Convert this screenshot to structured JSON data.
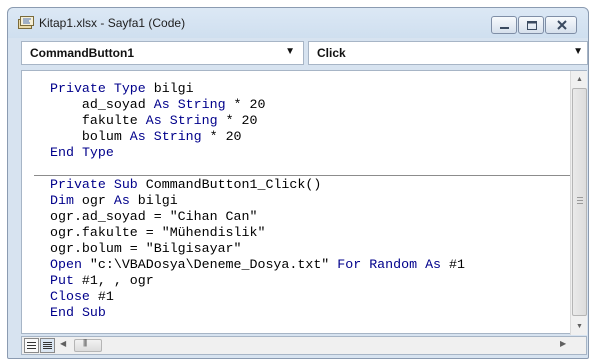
{
  "window": {
    "title": "Kitap1.xlsx - Sayfa1 (Code)",
    "icon": "vba-module-icon",
    "buttons": [
      "minimize-icon",
      "maximize-icon",
      "close-icon"
    ]
  },
  "object_combo": {
    "value": "CommandButton1"
  },
  "procedure_combo": {
    "value": "Click"
  },
  "code": {
    "lines": [
      "Private Type bilgi",
      "    ad_soyad As String * 20",
      "    fakulte As String * 20",
      "    bolum As String * 20",
      "End Type",
      "Private Sub CommandButton1_Click()",
      "Dim ogr As bilgi",
      "ogr.ad_soyad = \"Cihan Can\"",
      "ogr.fakulte = \"Mühendislik\"",
      "ogr.bolum = \"Bilgisayar\"",
      "Open \"c:\\VBADosya\\Deneme_Dosya.txt\" For Random As #1",
      "Put #1, , ogr",
      "Close #1",
      "End Sub"
    ]
  },
  "colors": {
    "keyword": "#00008b",
    "text": "#000000"
  }
}
